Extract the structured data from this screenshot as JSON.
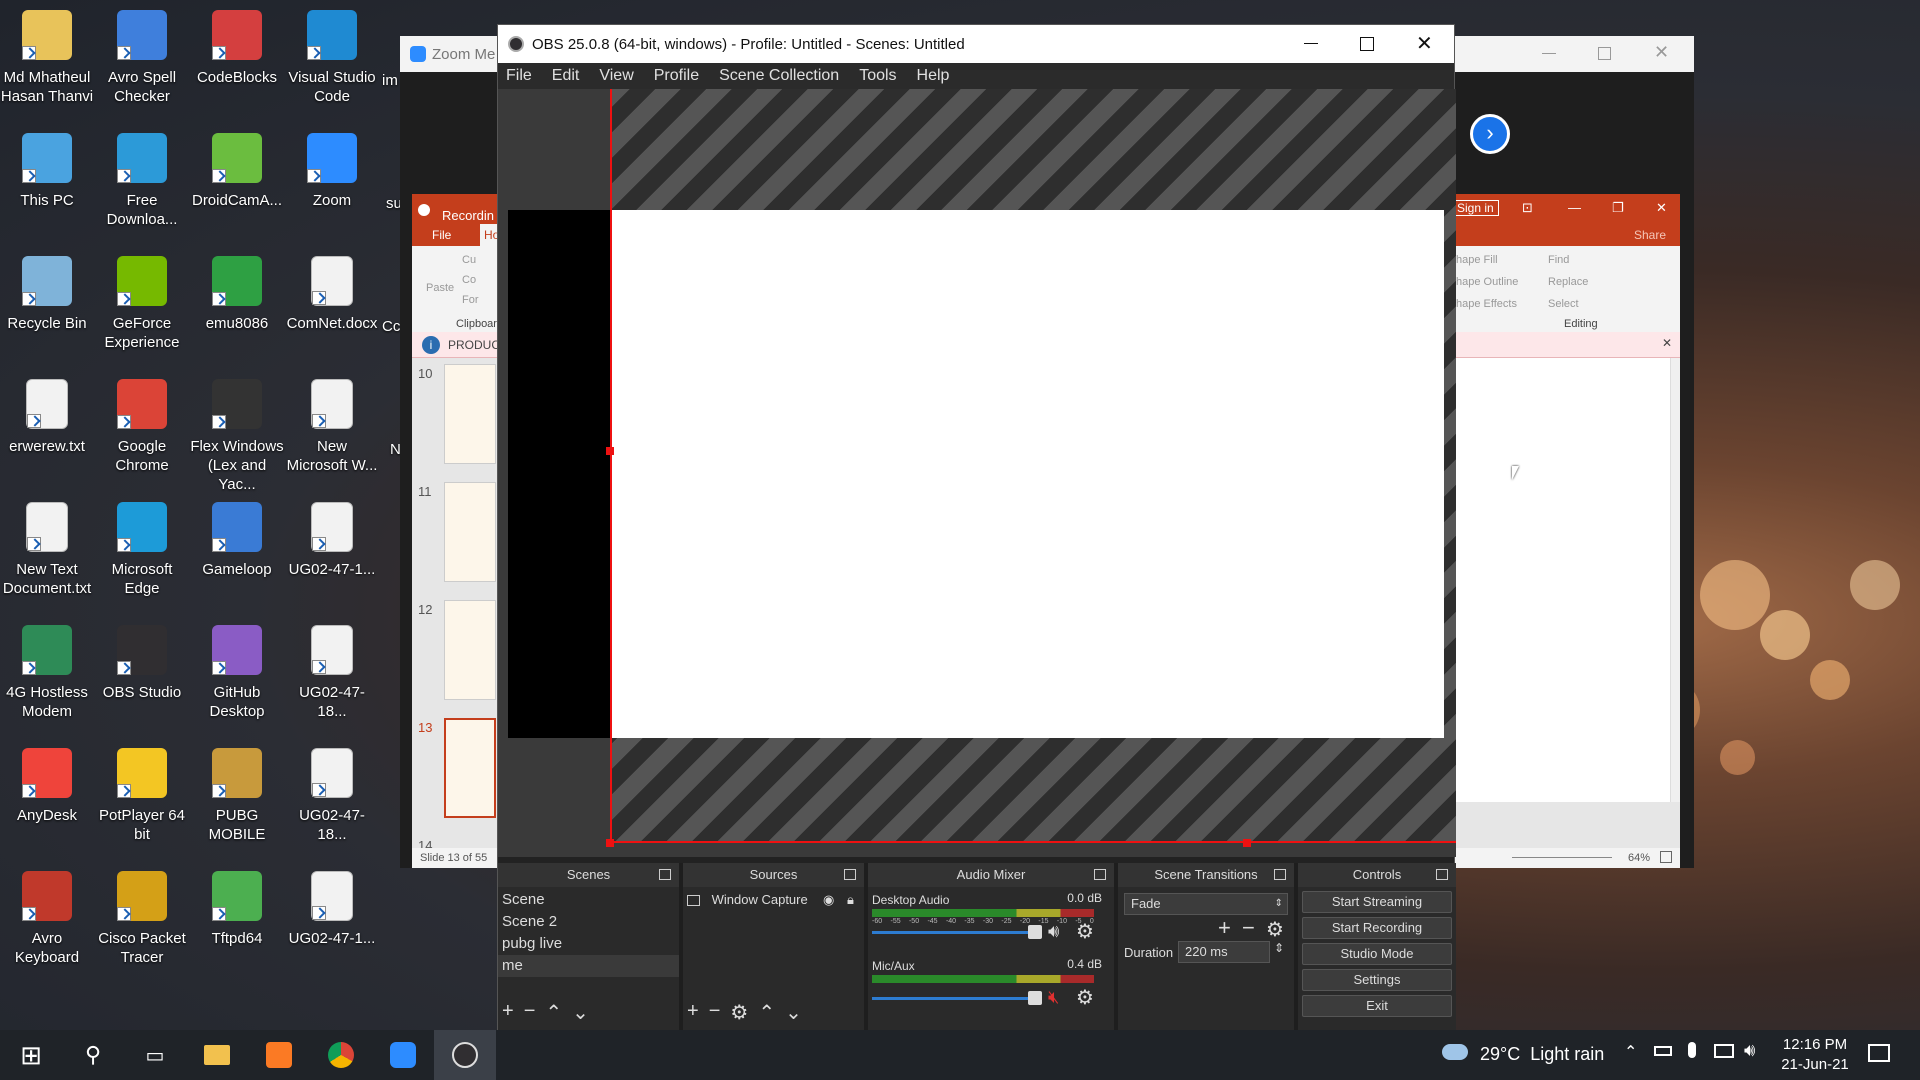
{
  "desktop": {
    "icons": [
      {
        "label": "Md Mhatheul Hasan Thanvi",
        "icon": "user-folder-icon",
        "color": "#e8c35a"
      },
      {
        "label": "Avro Spell Checker",
        "icon": "spell-check-icon",
        "color": "#3f7fdc"
      },
      {
        "label": "CodeBlocks",
        "icon": "codeblocks-icon",
        "color": "#d43f3f"
      },
      {
        "label": "Visual Studio Code",
        "icon": "vscode-icon",
        "color": "#1f8ad2"
      },
      {
        "label": "This PC",
        "icon": "computer-icon",
        "color": "#4aa3e0"
      },
      {
        "label": "Free Downloa...",
        "icon": "download-icon",
        "color": "#2c9ad8"
      },
      {
        "label": "DroidCamA...",
        "icon": "droidcam-icon",
        "color": "#6bbd3f"
      },
      {
        "label": "Zoom",
        "icon": "zoom-icon",
        "color": "#2d8cff"
      },
      {
        "label": "Recycle Bin",
        "icon": "recycle-bin-icon",
        "color": "#7fb3d9"
      },
      {
        "label": "GeForce Experience",
        "icon": "nvidia-icon",
        "color": "#76b900"
      },
      {
        "label": "emu8086",
        "icon": "chip-icon",
        "color": "#2ea043"
      },
      {
        "label": "ComNet.docx",
        "icon": "word-doc-icon",
        "color": "#f2f2f2"
      },
      {
        "label": "erwerew.txt",
        "icon": "text-file-icon",
        "color": "#f2f2f2"
      },
      {
        "label": "Google Chrome",
        "icon": "chrome-icon",
        "color": "#db4437"
      },
      {
        "label": "Flex Windows (Lex and Yac...",
        "icon": "apple-icon",
        "color": "#333333"
      },
      {
        "label": "New Microsoft W...",
        "icon": "word-doc-icon",
        "color": "#f2f2f2"
      },
      {
        "label": "New Text Document.txt",
        "icon": "text-file-icon",
        "color": "#f2f2f2"
      },
      {
        "label": "Microsoft Edge",
        "icon": "edge-icon",
        "color": "#1d9bd8"
      },
      {
        "label": "Gameloop",
        "icon": "gameloop-icon",
        "color": "#3a7bd5"
      },
      {
        "label": "UG02-47-1...",
        "icon": "word-doc-icon",
        "color": "#f2f2f2"
      },
      {
        "label": "4G Hostless Modem",
        "icon": "modem-icon",
        "color": "#2e8b57"
      },
      {
        "label": "OBS Studio",
        "icon": "obs-icon",
        "color": "#302e31"
      },
      {
        "label": "GitHub Desktop",
        "icon": "github-icon",
        "color": "#8a5cc5"
      },
      {
        "label": "UG02-47-18...",
        "icon": "word-doc-icon",
        "color": "#f2f2f2"
      },
      {
        "label": "AnyDesk",
        "icon": "anydesk-icon",
        "color": "#ef443b"
      },
      {
        "label": "PotPlayer 64 bit",
        "icon": "potplayer-icon",
        "color": "#f3c623"
      },
      {
        "label": "PUBG MOBILE",
        "icon": "pubg-icon",
        "color": "#c89a3c"
      },
      {
        "label": "UG02-47-18...",
        "icon": "word-doc-icon",
        "color": "#f2f2f2"
      },
      {
        "label": "Avro Keyboard",
        "icon": "avro-keyboard-icon",
        "color": "#c0392b"
      },
      {
        "label": "Cisco Packet Tracer",
        "icon": "packet-tracer-icon",
        "color": "#d4a017"
      },
      {
        "label": "Tftpd64",
        "icon": "tftp-icon",
        "color": "#4caf50"
      },
      {
        "label": "UG02-47-1...",
        "icon": "word-doc-icon",
        "color": "#f2f2f2"
      }
    ],
    "partial_labels": [
      "im",
      "su",
      "Cc",
      "N"
    ]
  },
  "zoom_window": {
    "title": "Zoom Me"
  },
  "powerpoint": {
    "title": "Recordin",
    "tabs": [
      "File",
      "Ho"
    ],
    "clipboard": {
      "paste": "Paste",
      "cut": "Cu",
      "copy": "Co",
      "format": "For",
      "group": "Clipboard"
    },
    "info_bar": "PRODUCT",
    "slides": [
      "10",
      "11",
      "12",
      "13",
      "14"
    ],
    "status": "Slide 13 of 55",
    "sign_in": "Sign in",
    "share": "Share",
    "drawing": [
      "hape Fill",
      "hape Outline",
      "hape Effects"
    ],
    "editing": {
      "find": "Find",
      "replace": "Replace",
      "select": "Select",
      "group": "Editing"
    },
    "zoom": "64%"
  },
  "obs": {
    "title": "OBS 25.0.8 (64-bit, windows) - Profile: Untitled - Scenes: Untitled",
    "menu": [
      "File",
      "Edit",
      "View",
      "Profile",
      "Scene Collection",
      "Tools",
      "Help"
    ],
    "docks": {
      "scenes": {
        "title": "Scenes",
        "items": [
          "Scene",
          "Scene 2",
          "pubg live",
          "me"
        ]
      },
      "sources": {
        "title": "Sources",
        "items": [
          "Window Capture"
        ]
      },
      "mixer": {
        "title": "Audio Mixer",
        "channels": [
          {
            "name": "Desktop Audio",
            "db": "0.0 dB",
            "muted": false
          },
          {
            "name": "Mic/Aux",
            "db": "0.4 dB",
            "muted": true
          }
        ],
        "scale": [
          "-60",
          "-55",
          "-50",
          "-45",
          "-40",
          "-35",
          "-30",
          "-25",
          "-20",
          "-15",
          "-10",
          "-5",
          "0"
        ]
      },
      "transitions": {
        "title": "Scene Transitions",
        "selected": "Fade",
        "duration_label": "Duration",
        "duration": "220 ms"
      },
      "controls": {
        "title": "Controls",
        "buttons": [
          "Start Streaming",
          "Start Recording",
          "Studio Mode",
          "Settings",
          "Exit"
        ]
      }
    }
  },
  "taskbar": {
    "weather": "29°C  Light rain",
    "time": "12:16 PM",
    "date": "21-Jun-21"
  }
}
